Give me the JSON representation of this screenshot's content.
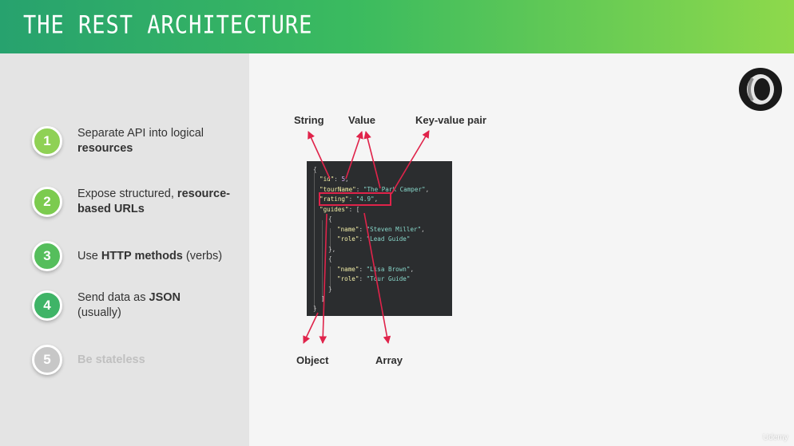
{
  "header": {
    "title": "THE REST ARCHITECTURE"
  },
  "colors": {
    "header_start": "#27a26e",
    "header_end": "#8ed94b",
    "highlight": "#e0234a",
    "step_active": "#6cc548",
    "step_disabled": "#c7c7c7"
  },
  "steps": [
    {
      "num": "1",
      "before": "Separate API into logical ",
      "bold": "resources",
      "after": ""
    },
    {
      "num": "2",
      "before": "Expose structured, ",
      "bold": "resource-based URLs",
      "after": ""
    },
    {
      "num": "3",
      "before": "Use ",
      "bold": "HTTP methods",
      "after": " (verbs)"
    },
    {
      "num": "4",
      "before": "Send data as ",
      "bold": "JSON",
      "after": " (usually)"
    },
    {
      "num": "5",
      "before": "",
      "bold": "Be stateless",
      "after": ""
    }
  ],
  "labels": {
    "string": "String",
    "value": "Value",
    "key_value": "Key-value pair",
    "object": "Object",
    "array": "Array"
  },
  "code": {
    "open_brace": "{",
    "id_key": "\"id\"",
    "id_val": "5",
    "tourName_key": "\"tourName\"",
    "tourName_val": "\"The Park Camper\"",
    "rating_key": "\"rating\"",
    "rating_val": "\"4.9\"",
    "guides_key": "\"guides\"",
    "guide1_name_key": "\"name\"",
    "guide1_name_val": "\"Steven Miller\"",
    "guide1_role_key": "\"role\"",
    "guide1_role_val": "\"Lead Guide\"",
    "guide2_name_key": "\"name\"",
    "guide2_name_val": "\"Lisa Brown\"",
    "guide2_role_key": "\"role\"",
    "guide2_role_val": "\"Tour Guide\""
  },
  "icons": {
    "logo": "json-logo-icon"
  },
  "watermark": "Udemy"
}
